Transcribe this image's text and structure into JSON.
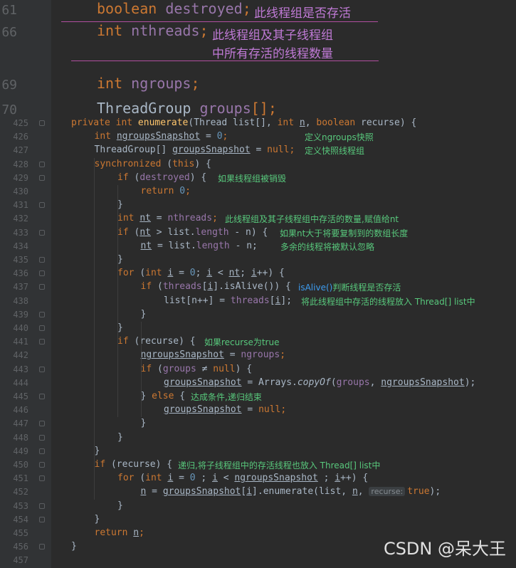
{
  "top_lines": [
    {
      "num": "61",
      "tokens": [
        {
          "t": "boolean ",
          "c": "kw"
        },
        {
          "t": "destroyed",
          "c": "fld"
        },
        {
          "t": ";",
          "c": "kw"
        }
      ],
      "note": "此线程组是否存活"
    },
    {
      "num": "66",
      "tokens": [
        {
          "t": "int ",
          "c": "kw"
        },
        {
          "t": "nthreads",
          "c": "fld"
        },
        {
          "t": ";",
          "c": "kw"
        }
      ],
      "note": "此线程组及其子线程组",
      "note2": "中所有存活的线程数量"
    },
    {
      "num": "69",
      "tokens": [
        {
          "t": "int ",
          "c": "kw"
        },
        {
          "t": "ngroups",
          "c": "fld"
        },
        {
          "t": ";",
          "c": "kw"
        }
      ]
    },
    {
      "num": "70",
      "tokens": [
        {
          "t": "ThreadGroup ",
          "c": ""
        },
        {
          "t": "groups",
          "c": "fld"
        },
        {
          "t": "[];",
          "c": "kw"
        }
      ]
    }
  ],
  "code_lines": [
    {
      "num": "425",
      "indent": 0,
      "tokens": [
        {
          "t": "private int ",
          "c": "kw"
        },
        {
          "t": "enumerate",
          "c": "fn"
        },
        {
          "t": "(Thread list[], "
        },
        {
          "t": "int ",
          "c": "kw"
        },
        {
          "t": "n",
          "c": "ul"
        },
        {
          "t": ", "
        },
        {
          "t": "boolean ",
          "c": "kw"
        },
        {
          "t": "recurse) {"
        }
      ]
    },
    {
      "num": "426",
      "indent": 1,
      "tokens": [
        {
          "t": "int ",
          "c": "kw"
        },
        {
          "t": "ngroupsSnapshot",
          "c": "ul"
        },
        {
          "t": " = "
        },
        {
          "t": "0",
          "c": "num-lit"
        },
        {
          "t": ";",
          "c": "kw"
        }
      ],
      "note": "定义ngroups快照"
    },
    {
      "num": "427",
      "indent": 1,
      "tokens": [
        {
          "t": "ThreadGroup[] "
        },
        {
          "t": "groupsSnapshot",
          "c": "ul"
        },
        {
          "t": " = "
        },
        {
          "t": "null",
          "c": "kw"
        },
        {
          "t": ";",
          "c": "kw"
        }
      ],
      "note": "定义快照线程组"
    },
    {
      "num": "428",
      "indent": 1,
      "tokens": [
        {
          "t": "synchronized ",
          "c": "kw"
        },
        {
          "t": "("
        },
        {
          "t": "this",
          "c": "kw"
        },
        {
          "t": ") {"
        }
      ]
    },
    {
      "num": "429",
      "indent": 2,
      "tokens": [
        {
          "t": "if ",
          "c": "kw"
        },
        {
          "t": "("
        },
        {
          "t": "destroyed",
          "c": "fld"
        },
        {
          "t": ") {"
        }
      ],
      "note": "如果线程组被销毁"
    },
    {
      "num": "430",
      "indent": 3,
      "tokens": [
        {
          "t": "return ",
          "c": "kw"
        },
        {
          "t": "0",
          "c": "num-lit"
        },
        {
          "t": ";",
          "c": "kw"
        }
      ]
    },
    {
      "num": "431",
      "indent": 2,
      "tokens": [
        {
          "t": "}"
        }
      ]
    },
    {
      "num": "432",
      "indent": 2,
      "tokens": [
        {
          "t": "int ",
          "c": "kw"
        },
        {
          "t": "nt",
          "c": "ul"
        },
        {
          "t": " = "
        },
        {
          "t": "nthreads",
          "c": "fld"
        },
        {
          "t": ";",
          "c": "kw"
        }
      ],
      "note": "此线程组及其子线程组中存活的数量,赋值给nt"
    },
    {
      "num": "433",
      "indent": 2,
      "tokens": [
        {
          "t": "if ",
          "c": "kw"
        },
        {
          "t": "("
        },
        {
          "t": "nt",
          "c": "ul"
        },
        {
          "t": " > list."
        },
        {
          "t": "length",
          "c": "fld"
        },
        {
          "t": " - n) {"
        }
      ],
      "note": "如果nt大于将要复制到的数组长度"
    },
    {
      "num": "434",
      "indent": 3,
      "tokens": [
        {
          "t": "nt",
          "c": "ul"
        },
        {
          "t": " = list."
        },
        {
          "t": "length",
          "c": "fld"
        },
        {
          "t": " - n;"
        }
      ],
      "note": "多余的线程将被默认忽略"
    },
    {
      "num": "435",
      "indent": 2,
      "tokens": [
        {
          "t": "}"
        }
      ]
    },
    {
      "num": "436",
      "indent": 2,
      "tokens": [
        {
          "t": "for ",
          "c": "kw"
        },
        {
          "t": "("
        },
        {
          "t": "int ",
          "c": "kw"
        },
        {
          "t": "i",
          "c": "ul"
        },
        {
          "t": " = "
        },
        {
          "t": "0",
          "c": "num-lit"
        },
        {
          "t": "; "
        },
        {
          "t": "i",
          "c": "ul"
        },
        {
          "t": " < "
        },
        {
          "t": "nt",
          "c": "ul"
        },
        {
          "t": "; "
        },
        {
          "t": "i",
          "c": "ul"
        },
        {
          "t": "++) {"
        }
      ]
    },
    {
      "num": "437",
      "indent": 3,
      "tokens": [
        {
          "t": "if ",
          "c": "kw"
        },
        {
          "t": "("
        },
        {
          "t": "threads",
          "c": "fld"
        },
        {
          "t": "["
        },
        {
          "t": "i",
          "c": "ul"
        },
        {
          "t": "].isAlive()) {"
        }
      ],
      "note_blue": "isAlive()",
      "note": "判断线程是否存活"
    },
    {
      "num": "438",
      "indent": 4,
      "tokens": [
        {
          "t": "list[n++] = "
        },
        {
          "t": "threads",
          "c": "fld"
        },
        {
          "t": "["
        },
        {
          "t": "i",
          "c": "ul"
        },
        {
          "t": "];"
        }
      ],
      "note": "将此线程组中存活的线程放入 Thread[] list中"
    },
    {
      "num": "439",
      "indent": 3,
      "tokens": [
        {
          "t": "}"
        }
      ]
    },
    {
      "num": "440",
      "indent": 2,
      "tokens": [
        {
          "t": "}"
        }
      ]
    },
    {
      "num": "441",
      "indent": 2,
      "tokens": [
        {
          "t": "if ",
          "c": "kw"
        },
        {
          "t": "(recurse) {"
        }
      ],
      "note": "如果recurse为true"
    },
    {
      "num": "442",
      "indent": 3,
      "tokens": [
        {
          "t": "ngroupsSnapshot",
          "c": "ul"
        },
        {
          "t": " = "
        },
        {
          "t": "ngroups",
          "c": "fld"
        },
        {
          "t": ";",
          "c": "kw"
        }
      ]
    },
    {
      "num": "443",
      "indent": 3,
      "tokens": [
        {
          "t": "if ",
          "c": "kw"
        },
        {
          "t": "("
        },
        {
          "t": "groups",
          "c": "fld"
        },
        {
          "t": " ≠ "
        },
        {
          "t": "null",
          "c": "kw"
        },
        {
          "t": ") {"
        }
      ]
    },
    {
      "num": "444",
      "indent": 4,
      "tokens": [
        {
          "t": "groupsSnapshot",
          "c": "ul"
        },
        {
          "t": " = Arrays."
        },
        {
          "t": "copyOf",
          "c": "it"
        },
        {
          "t": "("
        },
        {
          "t": "groups",
          "c": "fld"
        },
        {
          "t": ", "
        },
        {
          "t": "ngroupsSnapshot",
          "c": "ul"
        },
        {
          "t": ");"
        }
      ]
    },
    {
      "num": "445",
      "indent": 3,
      "tokens": [
        {
          "t": "} "
        },
        {
          "t": "else ",
          "c": "kw"
        },
        {
          "t": "{"
        }
      ],
      "note": "达成条件,递归结束"
    },
    {
      "num": "446",
      "indent": 4,
      "tokens": [
        {
          "t": "groupsSnapshot",
          "c": "ul"
        },
        {
          "t": " = "
        },
        {
          "t": "null",
          "c": "kw"
        },
        {
          "t": ";",
          "c": "kw"
        }
      ]
    },
    {
      "num": "447",
      "indent": 3,
      "tokens": [
        {
          "t": "}"
        }
      ]
    },
    {
      "num": "448",
      "indent": 2,
      "tokens": [
        {
          "t": "}"
        }
      ]
    },
    {
      "num": "449",
      "indent": 1,
      "tokens": [
        {
          "t": "}"
        }
      ]
    },
    {
      "num": "450",
      "indent": 1,
      "tokens": [
        {
          "t": "if ",
          "c": "kw"
        },
        {
          "t": "(recurse) {"
        }
      ],
      "note": "递归,将子线程组中的存活线程也放入 Thread[] list中"
    },
    {
      "num": "451",
      "indent": 2,
      "tokens": [
        {
          "t": "for ",
          "c": "kw"
        },
        {
          "t": "("
        },
        {
          "t": "int ",
          "c": "kw"
        },
        {
          "t": "i",
          "c": "ul"
        },
        {
          "t": " = "
        },
        {
          "t": "0",
          "c": "num-lit"
        },
        {
          "t": " ; "
        },
        {
          "t": "i",
          "c": "ul"
        },
        {
          "t": " < "
        },
        {
          "t": "ngroupsSnapshot",
          "c": "ul"
        },
        {
          "t": " ; "
        },
        {
          "t": "i",
          "c": "ul"
        },
        {
          "t": "++) {"
        }
      ]
    },
    {
      "num": "452",
      "indent": 3,
      "tokens": [
        {
          "t": "n",
          "c": "ul"
        },
        {
          "t": " = "
        },
        {
          "t": "groupsSnapshot",
          "c": "ul"
        },
        {
          "t": "["
        },
        {
          "t": "i",
          "c": "ul"
        },
        {
          "t": "].enumerate(list, "
        },
        {
          "t": "n",
          "c": "ul"
        },
        {
          "t": ", "
        },
        {
          "hint": "recurse:"
        },
        {
          "t": "true",
          "c": "kw"
        },
        {
          "t": ");"
        }
      ]
    },
    {
      "num": "453",
      "indent": 2,
      "tokens": [
        {
          "t": "}"
        }
      ]
    },
    {
      "num": "454",
      "indent": 1,
      "tokens": [
        {
          "t": "}"
        }
      ]
    },
    {
      "num": "455",
      "indent": 1,
      "tokens": [
        {
          "t": "return ",
          "c": "kw"
        },
        {
          "t": "n",
          "c": "ul"
        },
        {
          "t": ";",
          "c": "kw"
        }
      ]
    },
    {
      "num": "456",
      "indent": 0,
      "tokens": [
        {
          "t": "}"
        }
      ]
    },
    {
      "num": "457",
      "indent": 0,
      "tokens": []
    }
  ],
  "watermark": "CSDN @呆大王"
}
